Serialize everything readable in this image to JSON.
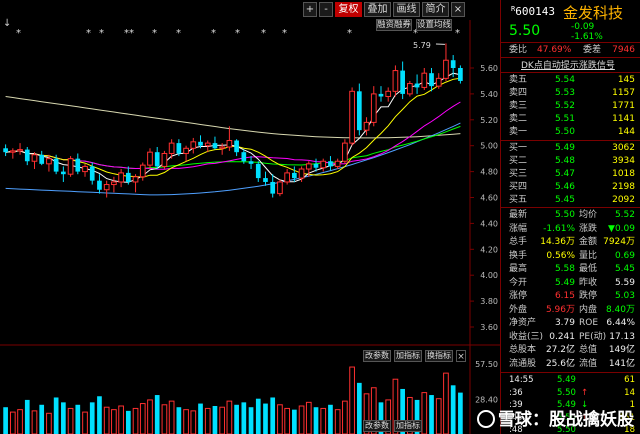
{
  "toolbar": {
    "plus": "+",
    "minus": "-",
    "fuquan": "复权",
    "diejia": "叠加",
    "peitong": "画线",
    "jieshao": "简介",
    "x": "×",
    "rongzi": "融资融券",
    "shezhi": "设置均线",
    "arrow": "↓"
  },
  "chart": {
    "y_ticks": [
      "5.60",
      "5.40",
      "5.20",
      "5.00",
      "4.80",
      "4.60",
      "4.40",
      "4.20",
      "4.00",
      "3.80",
      "3.60"
    ],
    "high_label": "5.79",
    "vol_ticks": [
      "57.50",
      "28.40"
    ],
    "btn_gaicanshu": "改参数",
    "btn_jiazhibiao": "加指标",
    "btn_huanzhibiao": "换指标",
    "btn_gaicanshu2": "改参数",
    "btn_jiazhibiao2": "加指标",
    "btn_huanzhibiao2": "换指标"
  },
  "chart_data": {
    "type": "candlestick",
    "candles": [
      [
        4.98,
        5.01,
        4.92,
        4.95
      ],
      [
        4.95,
        4.98,
        4.9,
        4.96
      ],
      [
        4.96,
        5.02,
        4.93,
        4.97
      ],
      [
        4.97,
        4.99,
        4.85,
        4.88
      ],
      [
        4.88,
        4.95,
        4.82,
        4.93
      ],
      [
        4.93,
        4.96,
        4.85,
        4.86
      ],
      [
        4.86,
        4.93,
        4.8,
        4.9
      ],
      [
        4.9,
        4.93,
        4.78,
        4.8
      ],
      [
        4.8,
        4.84,
        4.72,
        4.78
      ],
      [
        4.78,
        4.92,
        4.76,
        4.9
      ],
      [
        4.9,
        4.94,
        4.78,
        4.8
      ],
      [
        4.8,
        4.86,
        4.76,
        4.84
      ],
      [
        4.84,
        4.87,
        4.7,
        4.73
      ],
      [
        4.73,
        4.78,
        4.63,
        4.66
      ],
      [
        4.66,
        4.73,
        4.6,
        4.7
      ],
      [
        4.7,
        4.76,
        4.64,
        4.72
      ],
      [
        4.72,
        4.82,
        4.68,
        4.79
      ],
      [
        4.79,
        4.84,
        4.7,
        4.72
      ],
      [
        4.72,
        4.78,
        4.64,
        4.76
      ],
      [
        4.76,
        4.87,
        4.73,
        4.85
      ],
      [
        4.85,
        4.98,
        4.82,
        4.95
      ],
      [
        4.95,
        4.99,
        4.82,
        4.84
      ],
      [
        4.84,
        4.96,
        4.82,
        4.94
      ],
      [
        4.94,
        5.05,
        4.9,
        5.02
      ],
      [
        5.02,
        5.05,
        4.92,
        4.94
      ],
      [
        4.94,
        5.0,
        4.88,
        4.98
      ],
      [
        4.98,
        5.06,
        4.94,
        5.03
      ],
      [
        5.03,
        5.08,
        4.98,
        5.0
      ],
      [
        5.0,
        5.04,
        4.95,
        5.02
      ],
      [
        5.02,
        5.07,
        4.97,
        4.98
      ],
      [
        4.98,
        5.02,
        4.93,
        4.99
      ],
      [
        4.99,
        5.15,
        4.96,
        5.04
      ],
      [
        5.04,
        5.05,
        4.92,
        4.95
      ],
      [
        4.95,
        4.97,
        4.86,
        4.88
      ],
      [
        4.88,
        4.92,
        4.82,
        4.86
      ],
      [
        4.86,
        4.88,
        4.72,
        4.75
      ],
      [
        4.75,
        4.8,
        4.69,
        4.72
      ],
      [
        4.72,
        4.78,
        4.6,
        4.63
      ],
      [
        4.63,
        4.74,
        4.61,
        4.72
      ],
      [
        4.72,
        4.82,
        4.7,
        4.79
      ],
      [
        4.79,
        4.84,
        4.72,
        4.75
      ],
      [
        4.75,
        4.84,
        4.72,
        4.82
      ],
      [
        4.82,
        4.88,
        4.76,
        4.86
      ],
      [
        4.86,
        4.9,
        4.8,
        4.83
      ],
      [
        4.83,
        4.9,
        4.8,
        4.88
      ],
      [
        4.88,
        4.92,
        4.81,
        4.84
      ],
      [
        4.84,
        4.9,
        4.82,
        4.88
      ],
      [
        4.88,
        5.05,
        4.86,
        5.02
      ],
      [
        5.02,
        5.45,
        5.0,
        5.42
      ],
      [
        5.42,
        5.48,
        5.08,
        5.12
      ],
      [
        5.12,
        5.22,
        5.08,
        5.18
      ],
      [
        5.18,
        5.46,
        5.15,
        5.4
      ],
      [
        5.4,
        5.46,
        5.34,
        5.38
      ],
      [
        5.38,
        5.45,
        5.34,
        5.42
      ],
      [
        5.42,
        5.62,
        5.38,
        5.58
      ],
      [
        5.58,
        5.65,
        5.36,
        5.4
      ],
      [
        5.4,
        5.5,
        5.38,
        5.48
      ],
      [
        5.48,
        5.55,
        5.4,
        5.45
      ],
      [
        5.45,
        5.6,
        5.43,
        5.56
      ],
      [
        5.56,
        5.6,
        5.42,
        5.46
      ],
      [
        5.46,
        5.56,
        5.44,
        5.52
      ],
      [
        5.52,
        5.79,
        5.5,
        5.66
      ],
      [
        5.66,
        5.7,
        5.53,
        5.6
      ],
      [
        5.6,
        5.62,
        5.48,
        5.5
      ]
    ],
    "volumes": [
      22,
      18,
      20,
      28,
      19,
      24,
      17,
      30,
      26,
      21,
      24,
      18,
      26,
      31,
      22,
      20,
      23,
      19,
      21,
      25,
      28,
      32,
      24,
      27,
      22,
      20,
      19,
      25,
      21,
      23,
      22,
      27,
      24,
      26,
      22,
      29,
      25,
      30,
      24,
      21,
      20,
      23,
      26,
      22,
      21,
      24,
      20,
      27,
      55,
      42,
      33,
      38,
      26,
      28,
      45,
      37,
      30,
      28,
      34,
      32,
      29,
      50,
      40,
      34
    ],
    "ma": {
      "ma5_color": "#ffffff",
      "ma10_color": "#ffff00",
      "ma20_color": "#ff00ff",
      "ma30_color": "#00ff00",
      "ma60_color": "#4fa0ff",
      "ma120_color": "#d8d8b0"
    }
  },
  "panel": {
    "code": "600143",
    "name": "金发科技",
    "price": "5.50",
    "change": "-0.09",
    "change_pct": "-1.61%",
    "weibi_label": "委比",
    "weibi": "47.69%",
    "weicha_label": "委差",
    "weicha": "7946",
    "signal": "DK点自动提示涨跌信号",
    "asks": [
      {
        "label": "卖五",
        "price": "5.54",
        "vol": "145"
      },
      {
        "label": "卖四",
        "price": "5.53",
        "vol": "1157"
      },
      {
        "label": "卖三",
        "price": "5.52",
        "vol": "1771"
      },
      {
        "label": "卖二",
        "price": "5.51",
        "vol": "1141"
      },
      {
        "label": "卖一",
        "price": "5.50",
        "vol": "144"
      }
    ],
    "bids": [
      {
        "label": "买一",
        "price": "5.49",
        "vol": "3062"
      },
      {
        "label": "买二",
        "price": "5.48",
        "vol": "3934"
      },
      {
        "label": "买三",
        "price": "5.47",
        "vol": "1018"
      },
      {
        "label": "买四",
        "price": "5.46",
        "vol": "2198"
      },
      {
        "label": "买五",
        "price": "5.45",
        "vol": "2092"
      }
    ],
    "stats": [
      [
        {
          "l": "最新",
          "v": "5.50",
          "c": "g"
        },
        {
          "l": "均价",
          "v": "5.52",
          "c": "g"
        }
      ],
      [
        {
          "l": "涨幅",
          "v": "-1.61%",
          "c": "g"
        },
        {
          "l": "涨跌",
          "v": "▼0.09",
          "c": "g"
        }
      ],
      [
        {
          "l": "总手",
          "v": "14.36万",
          "c": "y"
        },
        {
          "l": "金额",
          "v": "7924万",
          "c": "y"
        }
      ],
      [
        {
          "l": "换手",
          "v": "0.56%",
          "c": "y"
        },
        {
          "l": "量比",
          "v": "0.69",
          "c": "g"
        }
      ],
      [
        {
          "l": "最高",
          "v": "5.58",
          "c": "g"
        },
        {
          "l": "最低",
          "v": "5.45",
          "c": "g"
        }
      ],
      [
        {
          "l": "今开",
          "v": "5.49",
          "c": "g"
        },
        {
          "l": "昨收",
          "v": "5.59",
          "c": "w"
        }
      ],
      [
        {
          "l": "涨停",
          "v": "6.15",
          "c": "r"
        },
        {
          "l": "跌停",
          "v": "5.03",
          "c": "g"
        }
      ],
      [
        {
          "l": "外盘",
          "v": "5.96万",
          "c": "r"
        },
        {
          "l": "内盘",
          "v": "8.40万",
          "c": "g"
        }
      ],
      [
        {
          "l": "净资产",
          "v": "3.79",
          "c": "w"
        },
        {
          "l": "ROE",
          "v": "6.44%",
          "c": "w"
        }
      ],
      [
        {
          "l": "收益(三)",
          "v": "0.241",
          "c": "w"
        },
        {
          "l": "PE(动)",
          "v": "17.13",
          "c": "w"
        }
      ],
      [
        {
          "l": "总股本",
          "v": "27.2亿",
          "c": "w"
        },
        {
          "l": "总值",
          "v": "149亿",
          "c": "w"
        }
      ],
      [
        {
          "l": "流通股",
          "v": "25.6亿",
          "c": "w"
        },
        {
          "l": "流值",
          "v": "141亿",
          "c": "w"
        }
      ]
    ],
    "ticks": [
      {
        "t": "14:55",
        "p": "5.49",
        "v": "61",
        "arrow": ""
      },
      {
        "t": ":36",
        "p": "5.50",
        "v": "14",
        "arrow": "↑"
      },
      {
        "t": ":39",
        "p": "5.49",
        "v": "1",
        "arrow": "↓"
      },
      {
        "t": ":45",
        "p": "5.50",
        "v": "151",
        "arrow": "↑"
      },
      {
        "t": ":48",
        "p": "5.50",
        "v": "18",
        "arrow": ""
      }
    ],
    "watermark": "雪球：股战擒妖股"
  }
}
